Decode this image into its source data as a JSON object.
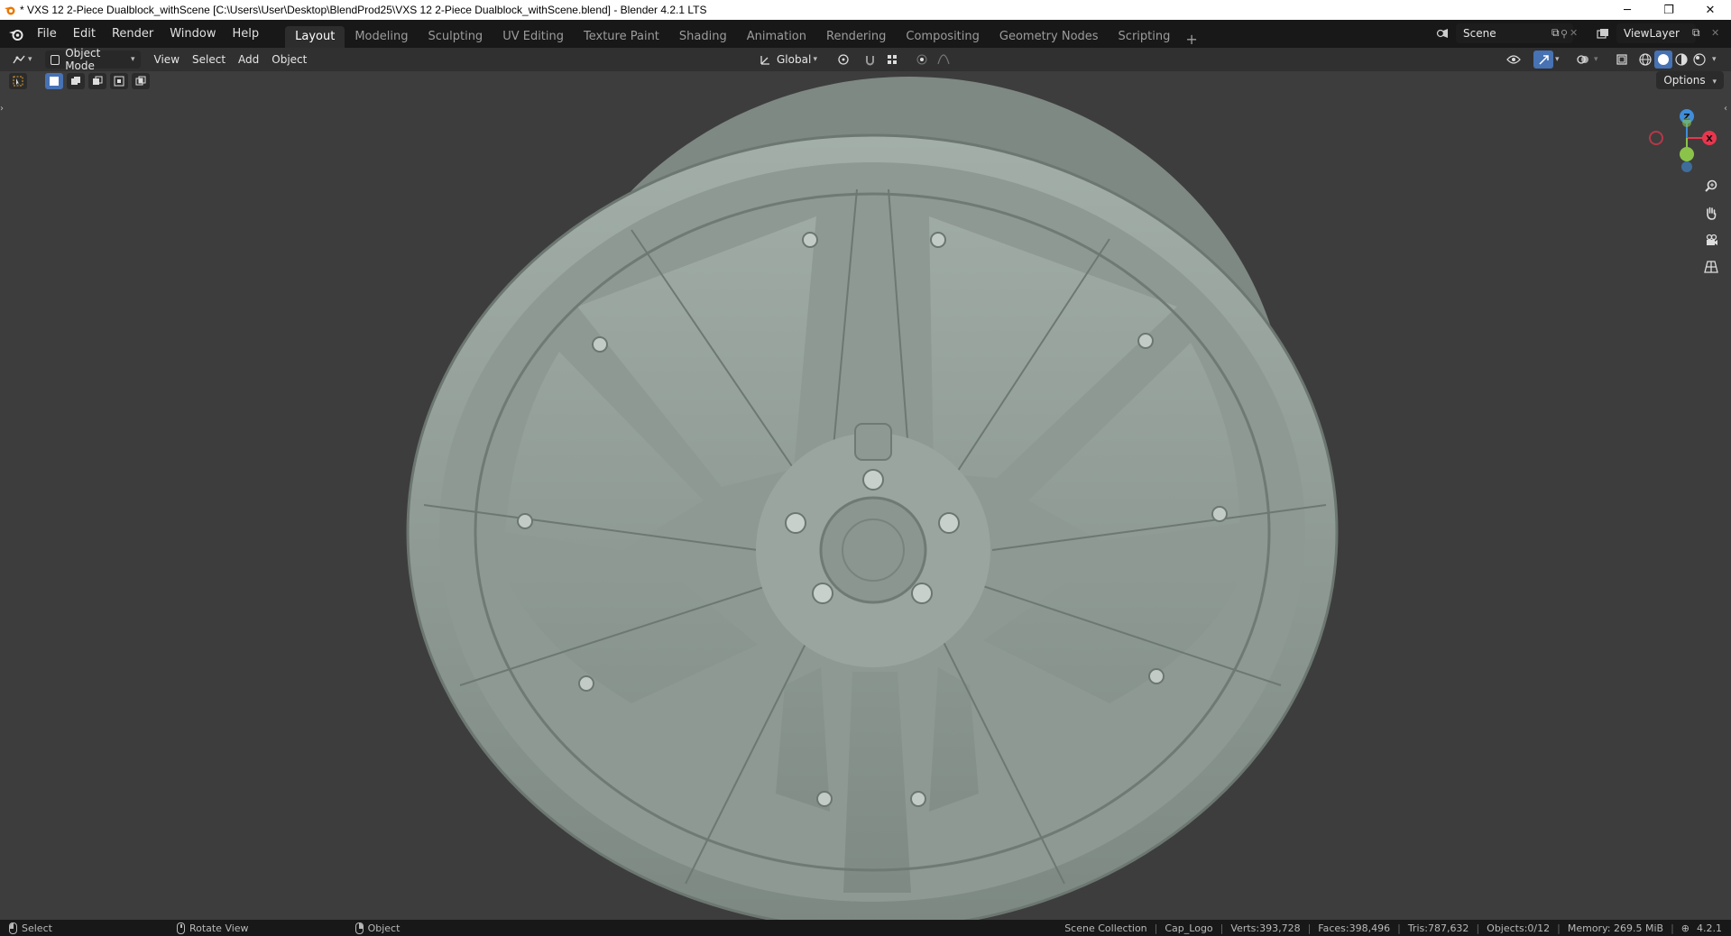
{
  "window": {
    "title": "* VXS 12 2-Piece Dualblock_withScene [C:\\Users\\User\\Desktop\\BlendProd25\\VXS 12 2-Piece Dualblock_withScene.blend] - Blender 4.2.1 LTS",
    "controls": {
      "minimize": "─",
      "restore": "❐",
      "close": "✕"
    }
  },
  "menu": [
    "File",
    "Edit",
    "Render",
    "Window",
    "Help"
  ],
  "workspaces": [
    {
      "label": "Layout",
      "active": true
    },
    {
      "label": "Modeling"
    },
    {
      "label": "Sculpting"
    },
    {
      "label": "UV Editing"
    },
    {
      "label": "Texture Paint"
    },
    {
      "label": "Shading"
    },
    {
      "label": "Animation"
    },
    {
      "label": "Rendering"
    },
    {
      "label": "Compositing"
    },
    {
      "label": "Geometry Nodes"
    },
    {
      "label": "Scripting"
    }
  ],
  "add_workspace": "+",
  "scene": {
    "label": "Scene"
  },
  "view_layer": {
    "label": "ViewLayer"
  },
  "header": {
    "mode": "Object Mode",
    "menus": [
      "View",
      "Select",
      "Add",
      "Object"
    ],
    "orientation": "Global"
  },
  "viewport": {
    "options_label": "Options",
    "gizmo": {
      "z": "Z",
      "x": "X",
      "y": "Y"
    },
    "colors": {
      "x": "#e8364f",
      "y": "#8bc34a",
      "z": "#3f8edb",
      "background": "#3d3d3d",
      "wheel": "#8a958f"
    }
  },
  "statusbar": {
    "select": "Select",
    "rotate": "Rotate View",
    "object": "Object",
    "collection": "Scene Collection",
    "active": "Cap_Logo",
    "verts": "Verts:393,728",
    "faces": "Faces:398,496",
    "tris": "Tris:787,632",
    "objects": "Objects:0/12",
    "memory": "Memory: 269.5 MiB",
    "version": "4.2.1"
  }
}
